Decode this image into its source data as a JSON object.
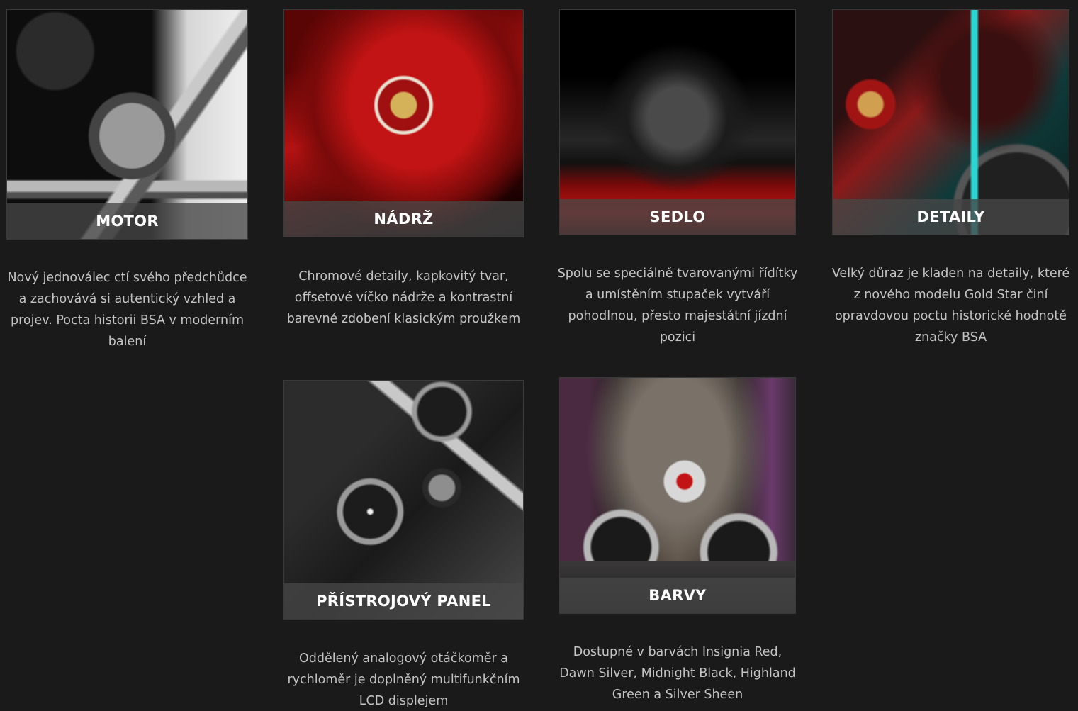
{
  "cards": [
    {
      "title": "MOTOR",
      "description": "Nový jednoválec ctí svého předchůdce a zachovává si autentický vzhled a projev. Pocta historii BSA v moderním balení"
    },
    {
      "title": "NÁDRŽ",
      "description": "Chromové detaily, kapkovitý tvar, offsetové víčko nádrže a kontrastní barevné zdobení klasickým proužkem"
    },
    {
      "title": "SEDLO",
      "description": "Spolu se speciálně tvarovanými řídítky a umístěním stupaček vytváří pohodlnou, přesto majestátní jízdní pozici"
    },
    {
      "title": "DETAILY",
      "description": "Velký důraz je kladen na detaily, které z nového modelu Gold Star činí opravdovou poctu historické hodnotě značky BSA"
    },
    {
      "title": "PŘÍSTROJOVÝ PANEL",
      "description": "Oddělený analogový otáčkoměr a rychloměr je doplněný multifunkčním LCD displejem"
    },
    {
      "title": "BARVY",
      "description": "Dostupné v barvách Insignia Red, Dawn Silver, Midnight Black, Highland Green a Silver Sheen"
    }
  ]
}
